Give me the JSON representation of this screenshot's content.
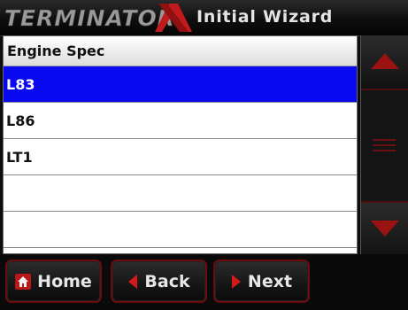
{
  "header": {
    "logo_text": "TERMINATOR X",
    "title": "Initial Wizard"
  },
  "list": {
    "column_header": "Engine Spec",
    "rows": [
      "L83",
      "L86",
      "LT1",
      "",
      ""
    ],
    "selected": "L83"
  },
  "footer": {
    "home_label": "Home",
    "back_label": "Back",
    "next_label": "Next"
  },
  "icons": {
    "scroll_up": "triangle-up-icon",
    "scroll_thumb": "grip-lines-icon",
    "scroll_down": "triangle-down-icon",
    "home": "home-icon",
    "back": "arrow-left-icon",
    "next": "arrow-right-icon"
  },
  "colors": {
    "selection": "#0a0af0",
    "accent_red": "#b81818",
    "button_border": "#6b0c0c"
  }
}
